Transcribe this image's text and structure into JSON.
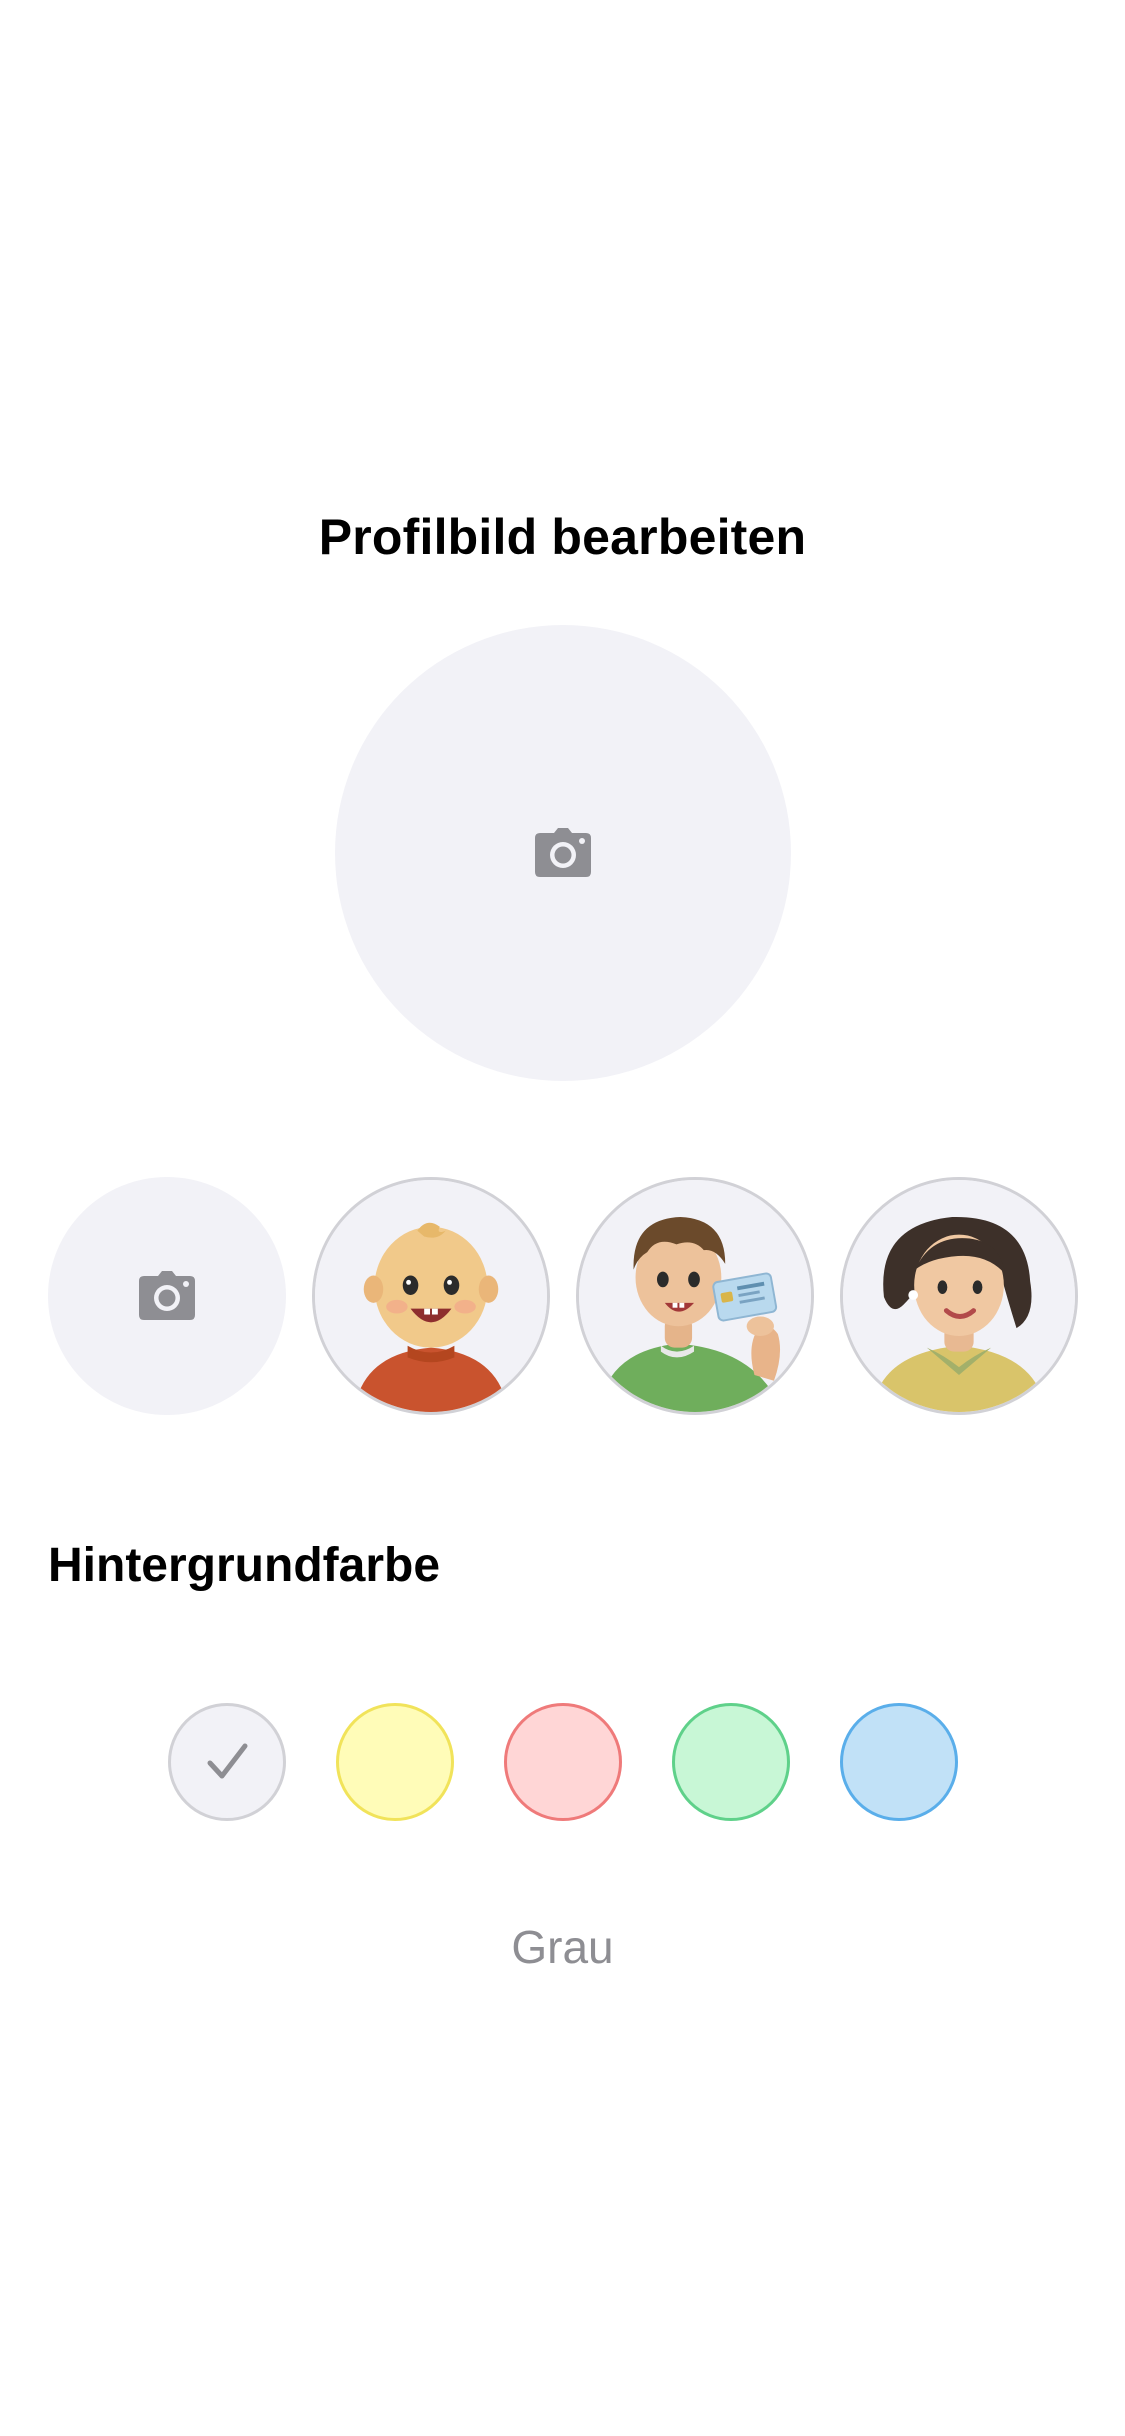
{
  "header": {
    "title": "Profilbild bearbeiten"
  },
  "main_avatar": {
    "icon": "camera-icon",
    "background": "#f2f2f7"
  },
  "avatar_options": [
    {
      "kind": "camera",
      "icon": "camera-icon"
    },
    {
      "kind": "avatar",
      "icon": "baby-avatar"
    },
    {
      "kind": "avatar",
      "icon": "boy-with-id-card-avatar"
    },
    {
      "kind": "avatar",
      "icon": "woman-avatar"
    }
  ],
  "background_section": {
    "heading": "Hintergrundfarbe",
    "selected_label": "Grau",
    "colors": [
      {
        "fill": "#f2f2f7",
        "border": "#d1d1d6",
        "selected": true
      },
      {
        "fill": "#fffcb8",
        "border": "#f1e35a",
        "selected": false
      },
      {
        "fill": "#ffd6d6",
        "border": "#ef7a7a",
        "selected": false
      },
      {
        "fill": "#c8f7d6",
        "border": "#5fd18a",
        "selected": false
      },
      {
        "fill": "#c1e1f7",
        "border": "#5aaeea",
        "selected": false
      }
    ]
  },
  "colors": {
    "icon_gray": "#8e8e93",
    "placeholder_bg": "#f2f2f7"
  }
}
